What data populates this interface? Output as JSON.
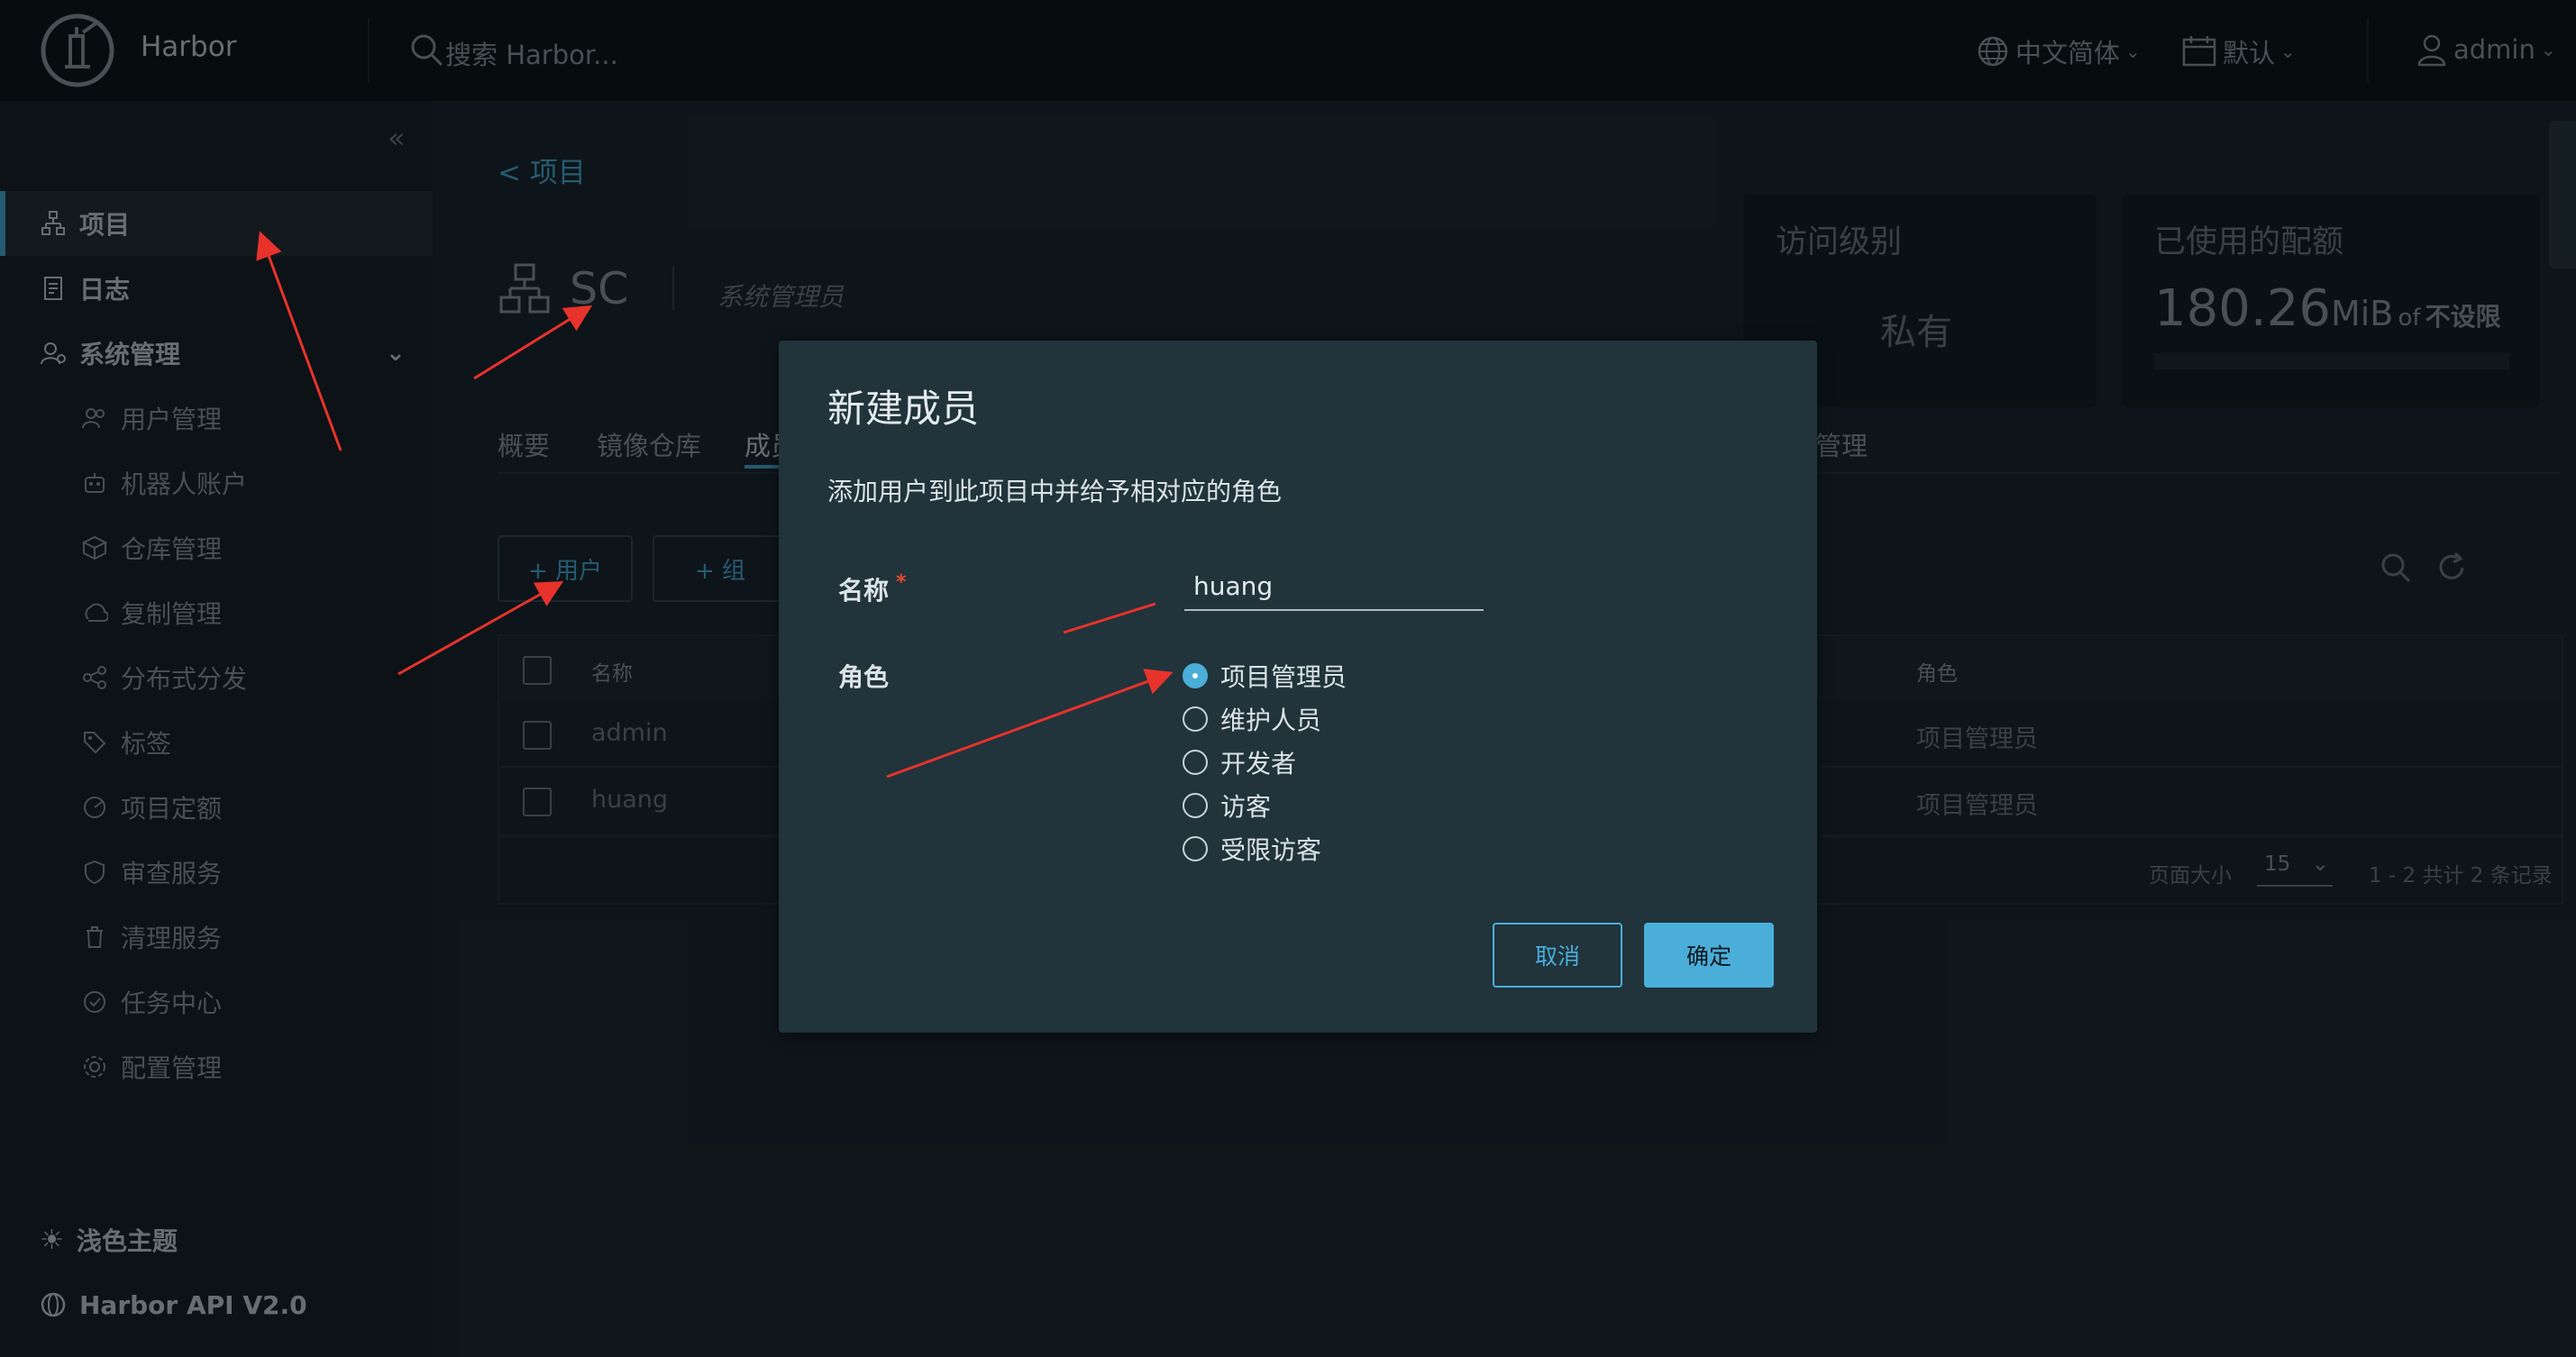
{
  "header": {
    "brand": "Harbor",
    "search_placeholder": "搜索 Harbor...",
    "language": "中文简体",
    "datetime_format": "默认",
    "user": "admin"
  },
  "sidebar": {
    "items": [
      {
        "label": "项目",
        "icon": "project-icon",
        "top": true,
        "active": true
      },
      {
        "label": "日志",
        "icon": "log-icon",
        "top": true
      },
      {
        "label": "系统管理",
        "icon": "admin-icon",
        "top": true,
        "expanded": true
      },
      {
        "label": "用户管理",
        "icon": "users-icon"
      },
      {
        "label": "机器人账户",
        "icon": "robot-icon"
      },
      {
        "label": "仓库管理",
        "icon": "registry-icon"
      },
      {
        "label": "复制管理",
        "icon": "replication-icon"
      },
      {
        "label": "分布式分发",
        "icon": "distribution-icon"
      },
      {
        "label": "标签",
        "icon": "tag-icon"
      },
      {
        "label": "项目定额",
        "icon": "quota-icon"
      },
      {
        "label": "审查服务",
        "icon": "shield-icon"
      },
      {
        "label": "清理服务",
        "icon": "trash-icon"
      },
      {
        "label": "任务中心",
        "icon": "tasks-icon"
      },
      {
        "label": "配置管理",
        "icon": "gear-icon"
      }
    ],
    "theme_toggle": "浅色主题",
    "api_link": "Harbor API V2.0"
  },
  "main": {
    "breadcrumb": "< 项目",
    "project_name": "SC",
    "project_role": "系统管理员",
    "access_level_label": "访问级别",
    "access_level_value": "私有",
    "quota_label": "已使用的配额",
    "quota_value": "180.26",
    "quota_unit": "MiB",
    "quota_of": "of",
    "quota_limit": "不设限",
    "tabs": [
      "概要",
      "镜像仓库",
      "成员",
      "管理"
    ],
    "active_tab": "成员",
    "add_user_button": "+ 用户",
    "add_group_button": "+ 组",
    "table": {
      "headers": [
        "名称",
        "角色"
      ],
      "rows": [
        {
          "name": "admin",
          "role": "项目管理员"
        },
        {
          "name": "huang",
          "role": "项目管理员"
        }
      ],
      "page_size_label": "页面大小",
      "page_size_value": "15",
      "pagination_summary": "1 - 2 共计 2 条记录"
    }
  },
  "modal": {
    "title": "新建成员",
    "description": "添加用户到此项目中并给予相对应的角色",
    "name_label": "名称",
    "name_required_mark": "*",
    "name_value": "huang",
    "role_label": "角色",
    "roles": [
      "项目管理员",
      "维护人员",
      "开发者",
      "访客",
      "受限访客"
    ],
    "selected_role": "项目管理员",
    "cancel_button": "取消",
    "confirm_button": "确定"
  },
  "colors": {
    "accent": "#4aaed9",
    "header_bg": "#0f171c",
    "annotation_arrow": "#e8322c"
  }
}
